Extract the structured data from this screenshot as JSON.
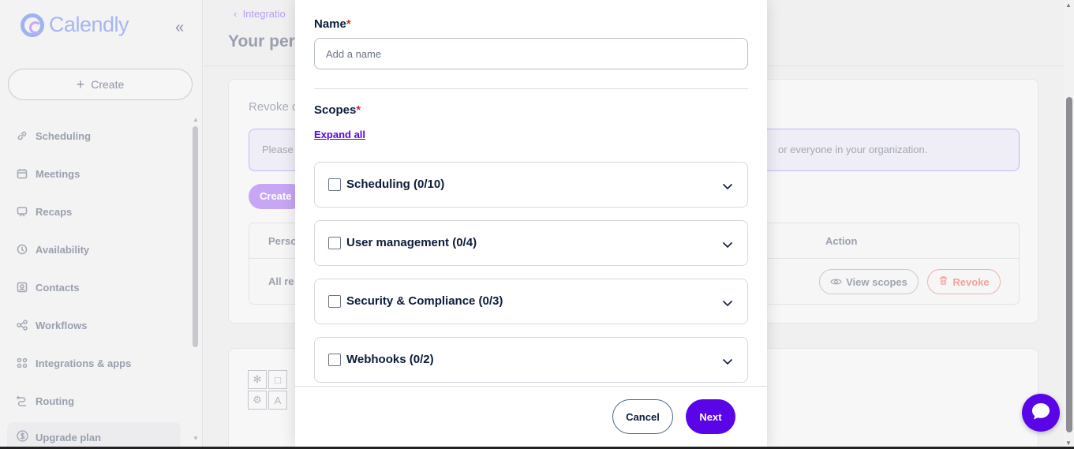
{
  "sidebar": {
    "logo_text": "Calendly",
    "collapse_glyph": "«",
    "create_label": "Create",
    "items": [
      {
        "label": "Scheduling",
        "icon": "link-icon"
      },
      {
        "label": "Meetings",
        "icon": "calendar-icon"
      },
      {
        "label": "Recaps",
        "icon": "recaps-icon"
      },
      {
        "label": "Availability",
        "icon": "clock-icon"
      },
      {
        "label": "Contacts",
        "icon": "contact-icon"
      },
      {
        "label": "Workflows",
        "icon": "workflow-icon"
      },
      {
        "label": "Integrations & apps",
        "icon": "grid-icon"
      },
      {
        "label": "Routing",
        "icon": "routing-icon"
      }
    ],
    "upgrade_label": "Upgrade plan"
  },
  "background": {
    "breadcrumb": "Integratio",
    "page_title": "Your per",
    "revoke_text": "Revoke c",
    "info_left": "Please",
    "info_right": "or everyone in your organization.",
    "create_button": "Create",
    "table": {
      "col_personal": "Perso",
      "col_action": "Action",
      "row_all": "All re",
      "view_scopes": "View scopes",
      "revoke": "Revoke"
    },
    "icon_tiles": [
      "✻",
      "□",
      "⚙",
      "A"
    ]
  },
  "modal": {
    "name_label": "Name",
    "required_marker": "*",
    "name_input": {
      "value": "",
      "placeholder": "Add a name"
    },
    "scopes_label": "Scopes",
    "expand_all": "Expand all",
    "scopes": [
      {
        "label": "Scheduling (0/10)",
        "checked": false
      },
      {
        "label": "User management (0/4)",
        "checked": false
      },
      {
        "label": "Security & Compliance (0/3)",
        "checked": false
      },
      {
        "label": "Webhooks (0/2)",
        "checked": false
      }
    ],
    "cancel_label": "Cancel",
    "next_label": "Next"
  },
  "colors": {
    "primary": "#5a05e8",
    "text": "#0b1d3a",
    "required": "#d62a2a",
    "border": "#d4d8df"
  }
}
